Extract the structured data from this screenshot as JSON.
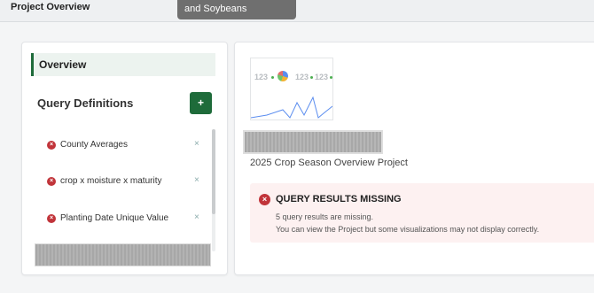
{
  "header": {
    "title": "Project Overview",
    "tooltip": "and Soybeans"
  },
  "sidebar": {
    "overview_label": "Overview",
    "query_definitions_heading": "Query Definitions",
    "add_button_label": "+",
    "items": [
      {
        "label": "County Averages",
        "status_icon": "error-icon",
        "remove_label": "×"
      },
      {
        "label": "crop x moisture x maturity",
        "status_icon": "error-icon",
        "remove_label": "×"
      },
      {
        "label": "Planting Date Unique Value",
        "status_icon": "error-icon",
        "remove_label": "×"
      }
    ]
  },
  "main": {
    "thumbnail": {
      "tiles": [
        "123",
        "123",
        "123"
      ]
    },
    "project_name": "2025 Crop Season Overview Project",
    "alert": {
      "icon_glyph": "×",
      "title": "QUERY RESULTS MISSING",
      "line1": "5 query results are missing.",
      "line2": "You can view the Project but some visualizations may not display correctly."
    }
  },
  "colors": {
    "accent": "#1e6b3a",
    "error": "#c1343a",
    "alert_bg": "#fdf1f1",
    "sparkline": "#5b8def"
  }
}
